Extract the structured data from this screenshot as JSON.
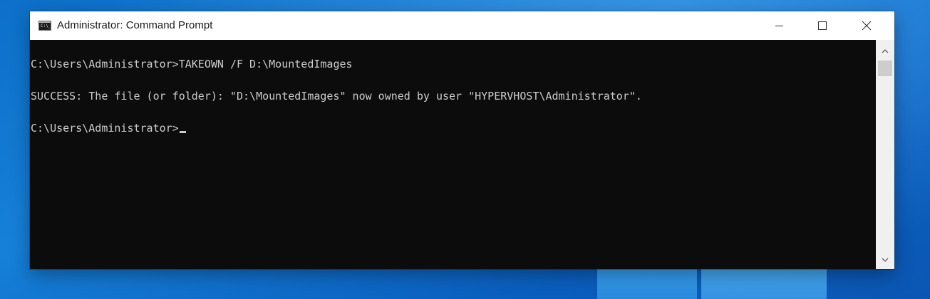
{
  "window": {
    "title": "Administrator: Command Prompt",
    "icon_name": "cmd-icon",
    "icon_text": "C:\\_"
  },
  "console": {
    "lines": [
      "C:\\Users\\Administrator>TAKEOWN /F D:\\MountedImages",
      "SUCCESS: The file (or folder): \"D:\\MountedImages\" now owned by user \"HYPERVHOST\\Administrator\".",
      "C:\\Users\\Administrator>"
    ],
    "text_color": "#cccccc",
    "background": "#0c0c0c"
  },
  "caption_buttons": {
    "minimize_icon": "minimize-icon",
    "maximize_icon": "maximize-icon",
    "close_icon": "close-icon"
  },
  "colors": {
    "desktop_blue": "#0d6fc9",
    "titlebar": "#ffffff"
  }
}
